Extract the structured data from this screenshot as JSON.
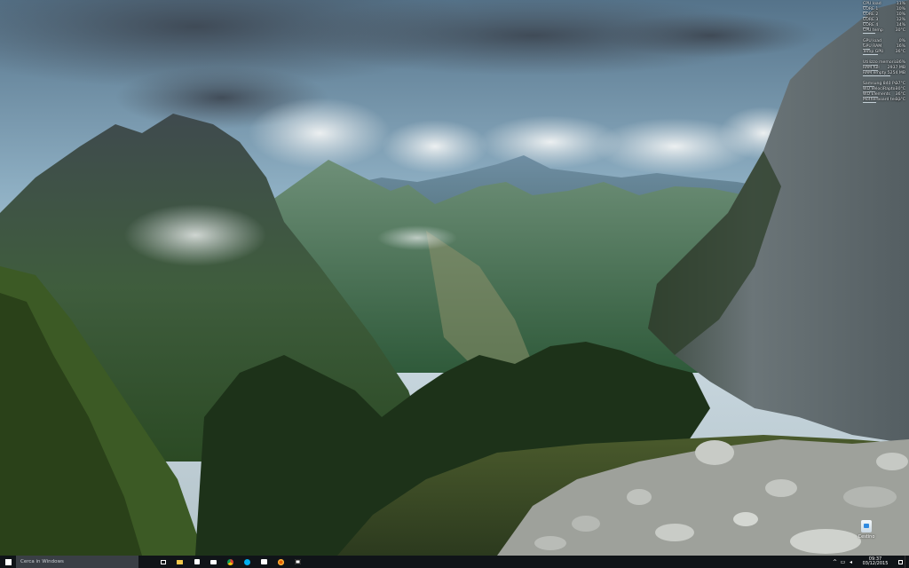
{
  "wallpaper": {
    "sky_top": "#5f7f96",
    "sky_bottom": "#c7d6de",
    "mountain_far": "#4e6d83",
    "mountain_mid": "#3f6a4c",
    "forest": "#20351f",
    "cliff": "#6f7a7e",
    "rocks": "#b9bcb8"
  },
  "sysmon": {
    "rows": [
      {
        "label": "CPU load",
        "value": "11%",
        "level": 0.11
      },
      {
        "label": "CORE 1",
        "value": "10%",
        "level": 0.1
      },
      {
        "label": "CORE 2",
        "value": "10%",
        "level": 0.1
      },
      {
        "label": "CORE 3",
        "value": "12%",
        "level": 0.12
      },
      {
        "label": "CORE 4",
        "value": "14%",
        "level": 0.14
      },
      {
        "label": "CPU temp",
        "value": "30°C",
        "level": 0.3
      },
      {
        "label": "GPU load",
        "value": "0%",
        "level": 0.0
      },
      {
        "label": "GPU RAM",
        "value": "16%",
        "level": 0.16
      },
      {
        "label": "Temp GPU",
        "value": "36°C",
        "level": 0.36
      },
      {
        "label": "Utilizzo memoria",
        "value": "36%",
        "level": 0.36
      },
      {
        "label": "RAM full",
        "value": "2937 MB",
        "level": 0.36
      },
      {
        "label": "RAM empty",
        "value": "5254 MB",
        "level": 0.64
      },
      {
        "label": "Samsung 840 Pro",
        "value": "27°C",
        "level": 0.27
      },
      {
        "label": "WD VelociRaptor",
        "value": "30°C",
        "level": 0.3
      },
      {
        "label": "WD Elements",
        "value": "36°C",
        "level": 0.36
      },
      {
        "label": "Motherboard temp",
        "value": "31°C",
        "level": 0.31
      }
    ]
  },
  "desktop": {
    "icons": [
      {
        "label": "Cestino",
        "icon": "recycle-bin-icon"
      }
    ]
  },
  "taskbar": {
    "search_placeholder": "Cerca in Windows",
    "pinned": [
      {
        "name": "task-view-icon"
      },
      {
        "name": "file-explorer-icon"
      },
      {
        "name": "store-icon"
      },
      {
        "name": "messaging-icon"
      },
      {
        "name": "chrome-icon"
      },
      {
        "name": "skype-icon"
      },
      {
        "name": "mail-icon"
      },
      {
        "name": "firefox-icon"
      },
      {
        "name": "media-player-icon"
      }
    ],
    "tray": {
      "time": "09:37",
      "date": "03/12/2015",
      "chevron": "^",
      "network": "▭",
      "volume": "◂"
    }
  }
}
